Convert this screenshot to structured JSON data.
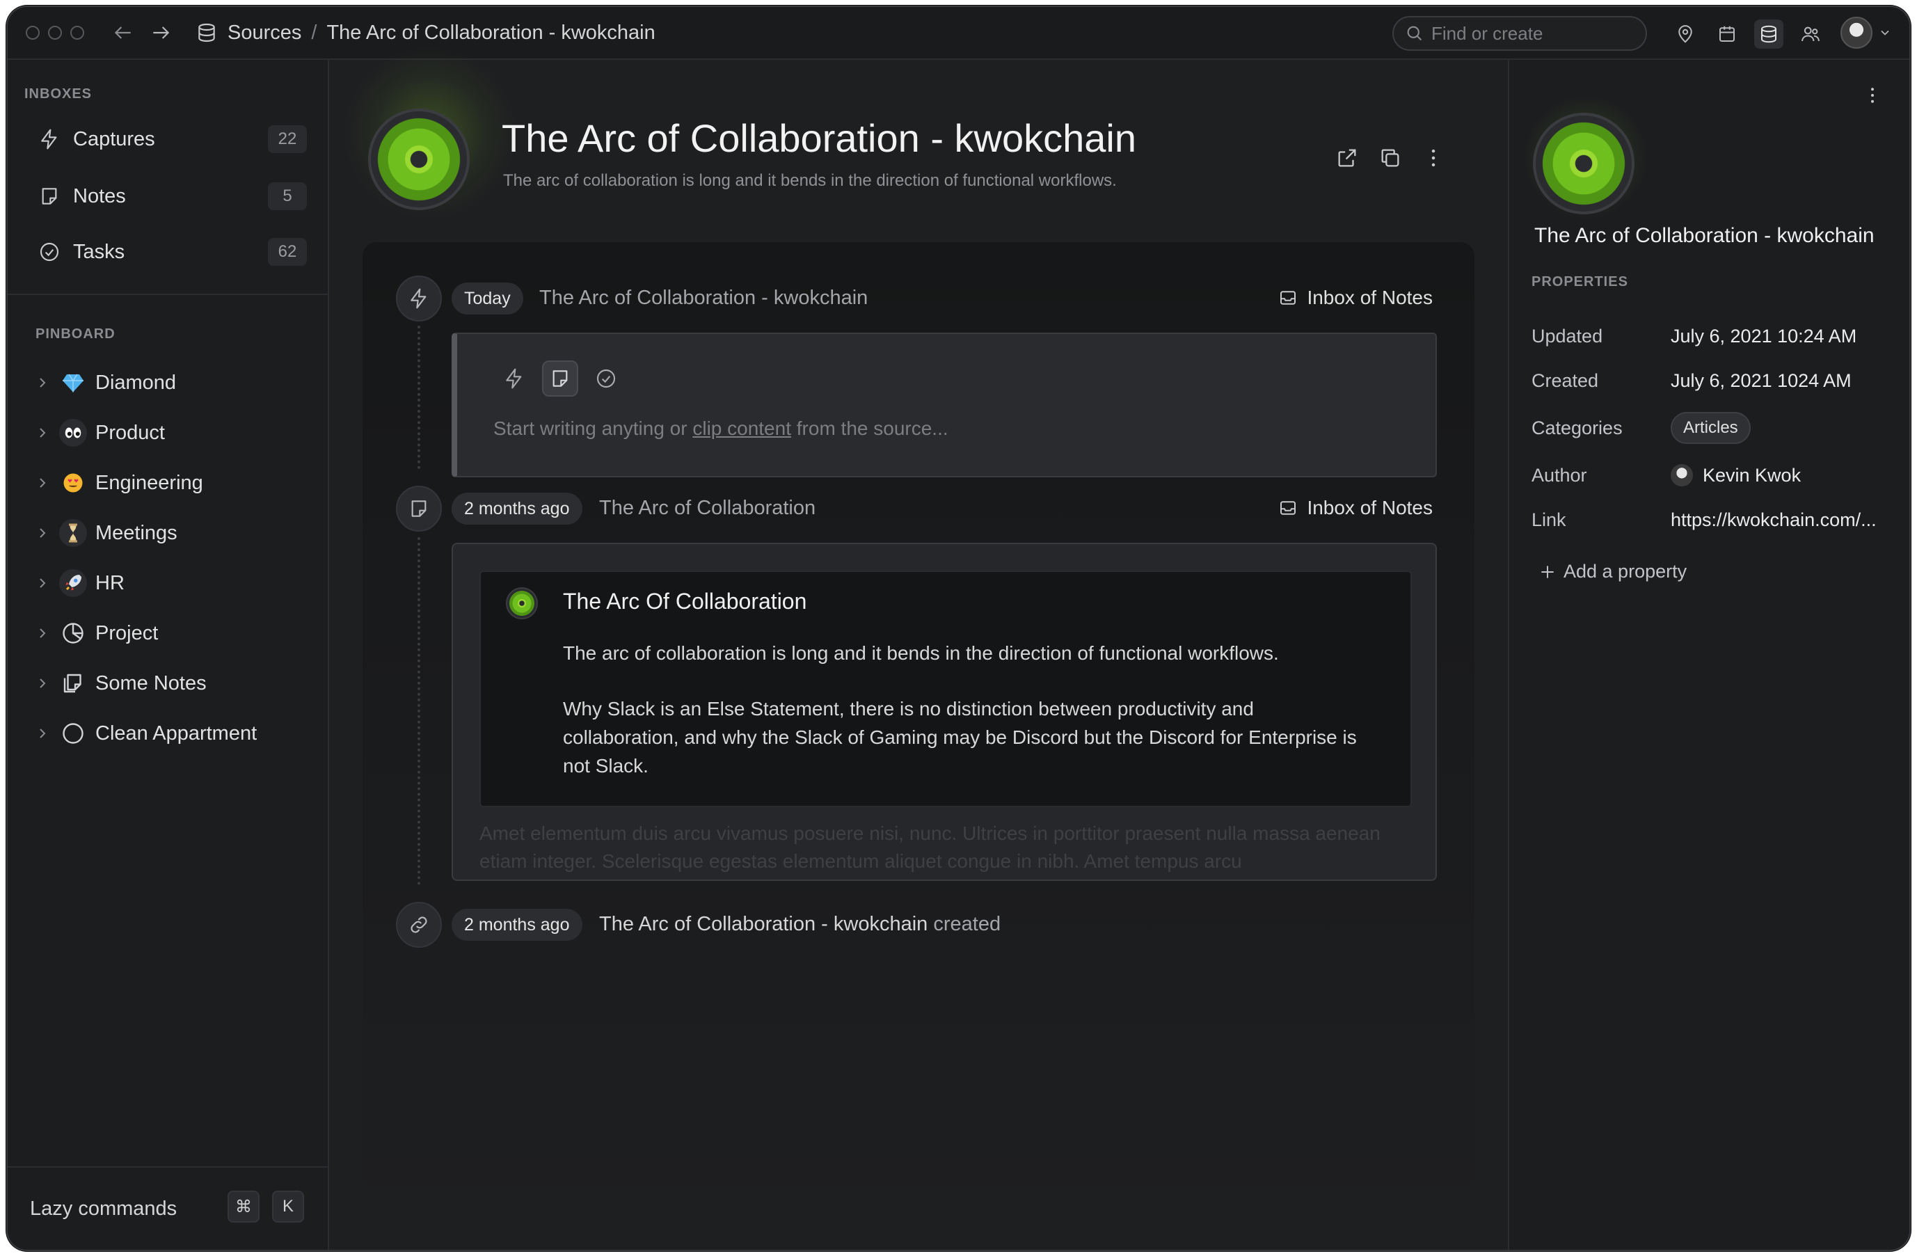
{
  "titlebar": {
    "breadcrumb_root": "Sources",
    "breadcrumb_sep": "/",
    "breadcrumb_current": "The Arc of Collaboration - kwokchain",
    "search_placeholder": "Find or create"
  },
  "sidebar": {
    "inboxes_label": "INBOXES",
    "inboxes": [
      {
        "label": "Captures",
        "count": "22",
        "icon": "bolt-icon"
      },
      {
        "label": "Notes",
        "count": "5",
        "icon": "note-icon"
      },
      {
        "label": "Tasks",
        "count": "62",
        "icon": "check-circle-icon"
      }
    ],
    "pinboard_label": "PINBOARD",
    "pinboard": [
      {
        "label": "Diamond",
        "icon": "diamond-icon"
      },
      {
        "label": "Product",
        "icon": "eyes-icon"
      },
      {
        "label": "Engineering",
        "icon": "heart-eyes-icon"
      },
      {
        "label": "Meetings",
        "icon": "hourglass-icon"
      },
      {
        "label": "HR",
        "icon": "rocket-icon"
      },
      {
        "label": "Project",
        "icon": "pie-icon"
      },
      {
        "label": "Some Notes",
        "icon": "notes-icon"
      },
      {
        "label": "Clean Appartment",
        "icon": "circle-icon"
      }
    ],
    "lazy_commands": "Lazy commands",
    "kbd_cmd": "⌘",
    "kbd_k": "K"
  },
  "main": {
    "title": "The Arc of Collaboration - kwokchain",
    "subtitle": "The arc of collaboration is long and it bends in the direction of functional workflows.",
    "feed": {
      "item1": {
        "chip": "Today",
        "title": "The Arc of Collaboration - kwokchain",
        "inbox": "Inbox of Notes",
        "placeholder_pre": "Start writing anyting or ",
        "placeholder_link": "clip content",
        "placeholder_post": " from the source..."
      },
      "item2": {
        "chip": "2 months ago",
        "title": "The Arc of Collaboration",
        "inbox": "Inbox of Notes",
        "card_title": "The Arc Of Collaboration",
        "card_p1": "The arc of collaboration is long and it bends in the direction of functional workflows.",
        "card_p2": "Why Slack is an Else Statement, there is no distinction between productivity and collaboration, and why the Slack of Gaming may be Discord but the Discord for Enterprise is not Slack.",
        "fade_text": "Amet elementum duis arcu vivamus posuere nisi, nunc. Ultrices in porttitor praesent nulla massa aenean etiam integer. Scelerisque egestas elementum aliquet congue in nibh. Amet tempus arcu"
      },
      "item3": {
        "chip": "2 months ago",
        "title": "The Arc of Collaboration - kwokchain",
        "suffix": " created"
      }
    }
  },
  "rpanel": {
    "title": "The Arc of Collaboration - kwokchain",
    "properties_label": "PROPERTIES",
    "props": {
      "updated_key": "Updated",
      "updated_val": "July 6, 2021 10:24 AM",
      "created_key": "Created",
      "created_val": "July 6, 2021 1024 AM",
      "categories_key": "Categories",
      "categories_val": "Articles",
      "author_key": "Author",
      "author_val": "Kevin Kwok",
      "link_key": "Link",
      "link_val": "https://kwokchain.com/..."
    },
    "add_property": "Add a property"
  },
  "colors": {
    "background": "#1d1e20",
    "accent_green": "#6fbf1e",
    "text_primary": "#f0f0f0",
    "text_muted": "#8f9195"
  }
}
